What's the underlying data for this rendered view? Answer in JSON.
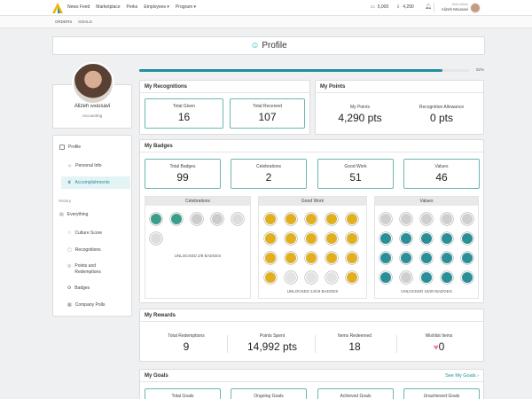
{
  "topbar": {
    "nav": [
      "News Feed",
      "Marketplace",
      "Perks",
      "Employees ▾",
      "Program ▾"
    ],
    "points": "5,000",
    "received": "4,290",
    "user_hello": "Hello Alizeh",
    "user_name": "Alizeh Mousavi"
  },
  "subbar": {
    "crumbs": [
      "ORDERS",
      "GOALS"
    ]
  },
  "profile": {
    "title": "Profile",
    "progress_pct": "92%",
    "progress_value": 0.92,
    "name": "Alizeh Mousavi",
    "department": "Accounting"
  },
  "sidebar": {
    "items": [
      {
        "label": "Profile"
      },
      {
        "label": "Personal Info"
      },
      {
        "label": "Accomplishments"
      }
    ],
    "history_label": "History",
    "history_items": [
      {
        "label": "Everything"
      },
      {
        "label": "Culture Score"
      },
      {
        "label": "Recognitions"
      },
      {
        "label": "Points and Redemptions"
      },
      {
        "label": "Badges"
      },
      {
        "label": "Company Polls"
      }
    ]
  },
  "recognitions": {
    "title": "My Recognitions",
    "given_label": "Total Given",
    "given": "16",
    "received_label": "Total Received",
    "received": "107"
  },
  "points": {
    "title": "My Points",
    "points_label": "My Points",
    "points": "4,290 pts",
    "allowance_label": "Recognition Allowance",
    "allowance": "0 pts"
  },
  "badges": {
    "title": "My Badges",
    "stats": [
      {
        "label": "Total Badges",
        "value": "99"
      },
      {
        "label": "Celebrations",
        "value": "2"
      },
      {
        "label": "Good Work",
        "value": "51"
      },
      {
        "label": "Values",
        "value": "46"
      }
    ],
    "celebrations_title": "Celebrations",
    "celebrations_unlocked": "UNLOCKED 2/8 BADGES",
    "goodwork_title": "Good Work",
    "goodwork_unlocked": "UNLOCKED 14/19 BADGES",
    "values_title": "Values",
    "values_unlocked": "UNLOCKED 15/20 BADGES"
  },
  "rewards": {
    "title": "My Rewards",
    "cols": [
      {
        "label": "Total Redemptions",
        "value": "9"
      },
      {
        "label": "Points Spent",
        "value": "14,992 pts"
      },
      {
        "label": "Items Redeemed",
        "value": "18"
      },
      {
        "label": "Wishlist Items",
        "value": "0"
      }
    ]
  },
  "goals": {
    "title": "My Goals",
    "see_all": "See My Goals",
    "cols": [
      "Total Goals",
      "Ongoing Goals",
      "Achieved Goals",
      "Unachieved Goals"
    ]
  },
  "colors": {
    "accent": "#1f8ea0",
    "gold": "#e0b020",
    "teal": "#2b8f98",
    "heart": "#e88a9a"
  }
}
